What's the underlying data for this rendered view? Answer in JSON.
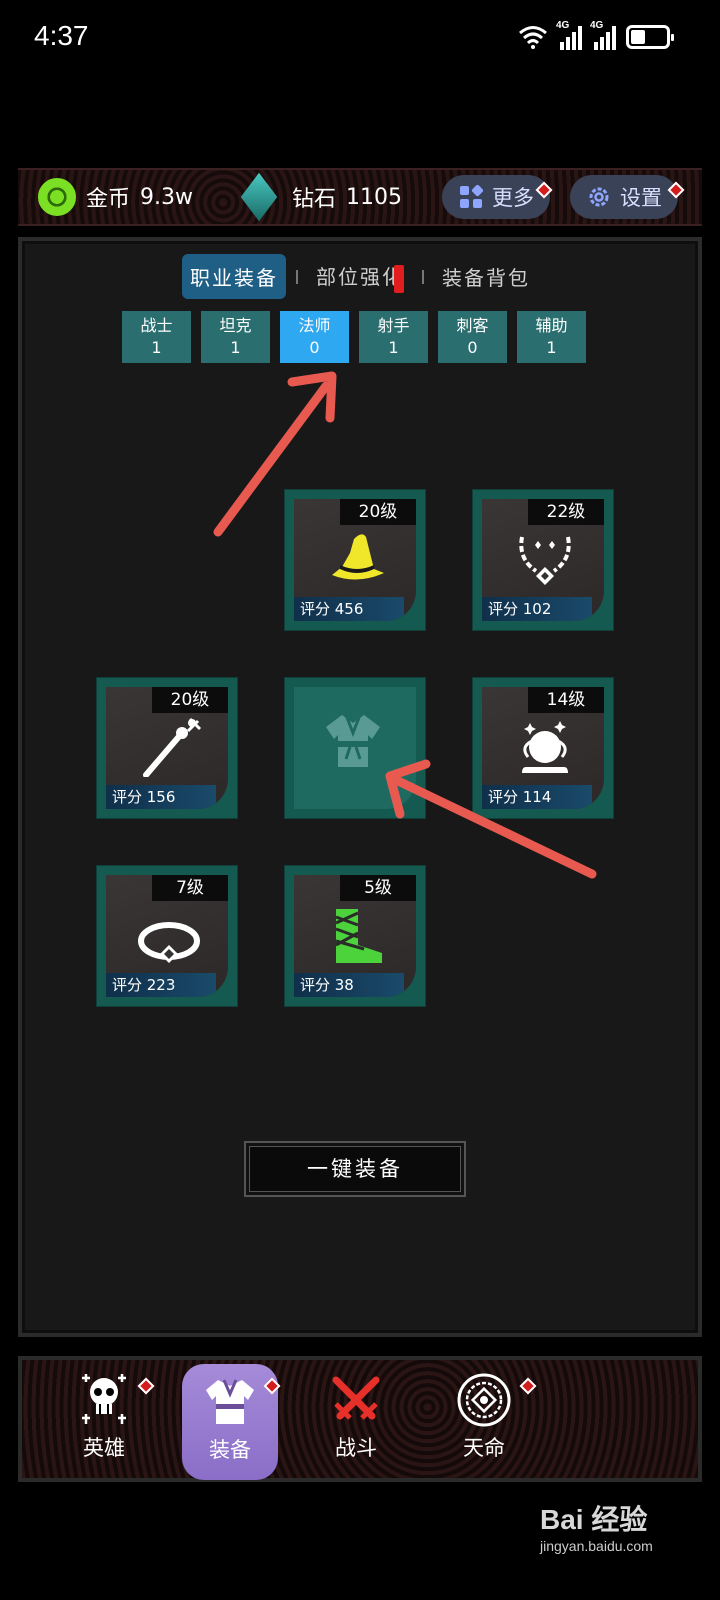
{
  "status": {
    "time": "4:37",
    "net1": "4G",
    "net2": "4G"
  },
  "topbar": {
    "gold_label": "金币",
    "gold_value": "9.3w",
    "diamond_label": "钻石",
    "diamond_value": "1105",
    "more_label": "更多",
    "settings_label": "设置"
  },
  "tabs": [
    {
      "label": "职业装备",
      "active": true
    },
    {
      "label": "部位强化",
      "active": false
    },
    {
      "label": "装备背包",
      "active": false
    }
  ],
  "classes": [
    {
      "name": "战士",
      "count": "1"
    },
    {
      "name": "坦克",
      "count": "1"
    },
    {
      "name": "法师",
      "count": "0",
      "active": true
    },
    {
      "name": "射手",
      "count": "1"
    },
    {
      "name": "刺客",
      "count": "0"
    },
    {
      "name": "辅助",
      "count": "1"
    }
  ],
  "slots": {
    "hat": {
      "level": "20级",
      "score": "评分 456",
      "icon": "wizard-hat-icon"
    },
    "necklace": {
      "level": "22级",
      "score": "评分 102",
      "icon": "necklace-icon"
    },
    "weapon": {
      "level": "20级",
      "score": "评分 156",
      "icon": "staff-icon"
    },
    "armor": {
      "icon": "robe-icon"
    },
    "orb": {
      "level": "14级",
      "score": "评分 114",
      "icon": "crystal-ball-icon"
    },
    "ring": {
      "level": "7级",
      "score": "评分 223",
      "icon": "ring-icon"
    },
    "boots": {
      "level": "5级",
      "score": "评分 38",
      "icon": "boot-icon"
    }
  },
  "one_key_label": "一键装备",
  "nav": [
    {
      "label": "英雄",
      "icon": "skull-icon"
    },
    {
      "label": "装备",
      "icon": "armor-icon",
      "active": true
    },
    {
      "label": "战斗",
      "icon": "crossed-swords-icon"
    },
    {
      "label": "天命",
      "icon": "mandala-icon"
    }
  ],
  "watermark": {
    "brand": "Bai 经验",
    "url": "jingyan.baidu.com"
  },
  "colors": {
    "accent_blue": "#2ea8f0",
    "teal": "#2a6e70",
    "alert_red": "#d31c1c",
    "nav_active": "#a58bd8"
  }
}
